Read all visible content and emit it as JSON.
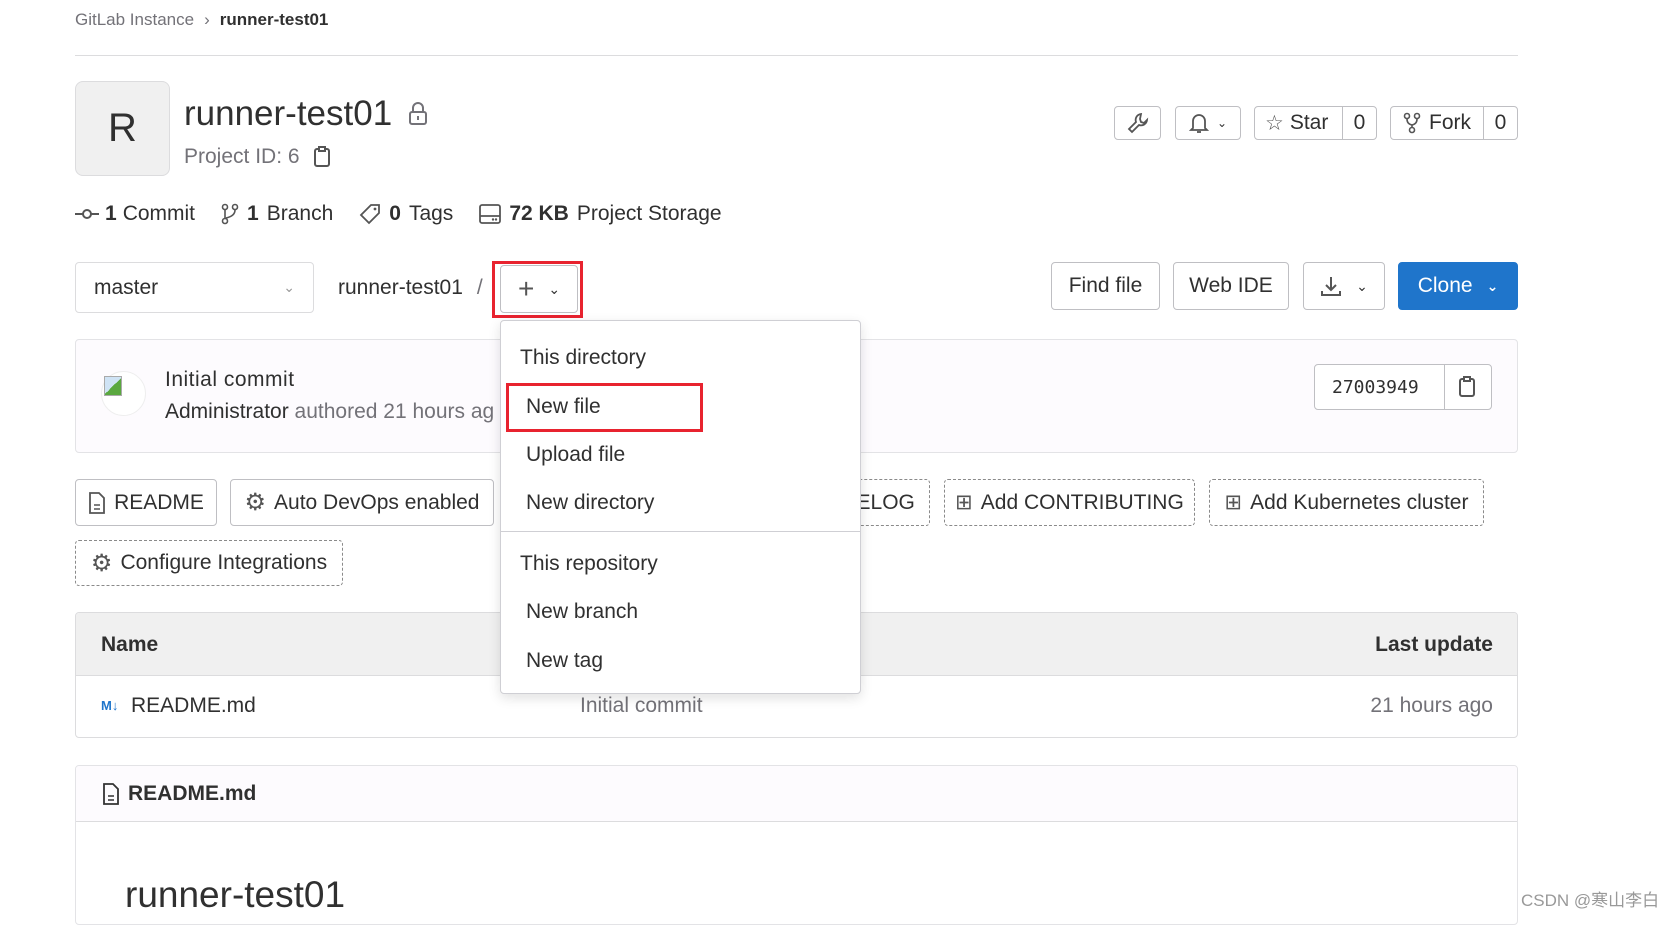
{
  "breadcrumb": {
    "parent": "GitLab Instance",
    "current": "runner-test01"
  },
  "project": {
    "avatar_letter": "R",
    "name": "runner-test01",
    "id_label": "Project ID: 6"
  },
  "header_actions": {
    "star_label": "Star",
    "star_count": "0",
    "fork_label": "Fork",
    "fork_count": "0"
  },
  "stats": [
    {
      "num": "1",
      "label": "Commit",
      "icon": "commit-icon"
    },
    {
      "num": "1",
      "label": "Branch",
      "icon": "branch-icon"
    },
    {
      "num": "0",
      "label": "Tags",
      "icon": "tag-icon"
    },
    {
      "num": "72 KB",
      "label": "Project Storage",
      "icon": "storage-icon"
    }
  ],
  "repo_nav": {
    "branch": "master",
    "path": "runner-test01",
    "sep": "/",
    "find_file": "Find file",
    "web_ide": "Web IDE",
    "clone": "Clone"
  },
  "last_commit": {
    "title": "Initial commit",
    "author": "Administrator",
    "meta": "authored 21 hours ag",
    "sha": "27003949"
  },
  "quick_actions": [
    "README",
    "Auto DevOps enabled",
    "CHANGELOG",
    "Add CONTRIBUTING",
    "Add Kubernetes cluster",
    "Configure Integrations"
  ],
  "table": {
    "headers": {
      "name": "Name",
      "last_update": "Last update"
    },
    "rows": [
      {
        "name": "README.md",
        "commit": "Initial commit",
        "updated": "21 hours ago"
      }
    ]
  },
  "readme": {
    "filename": "README.md",
    "heading": "runner-test01"
  },
  "dropdown": {
    "section1": "This directory",
    "items1": [
      "New file",
      "Upload file",
      "New directory"
    ],
    "section2": "This repository",
    "items2": [
      "New branch",
      "New tag"
    ]
  },
  "watermark": "CSDN @寒山李白",
  "colors": {
    "primary": "#1f75cb",
    "highlight": "#e8232f"
  }
}
